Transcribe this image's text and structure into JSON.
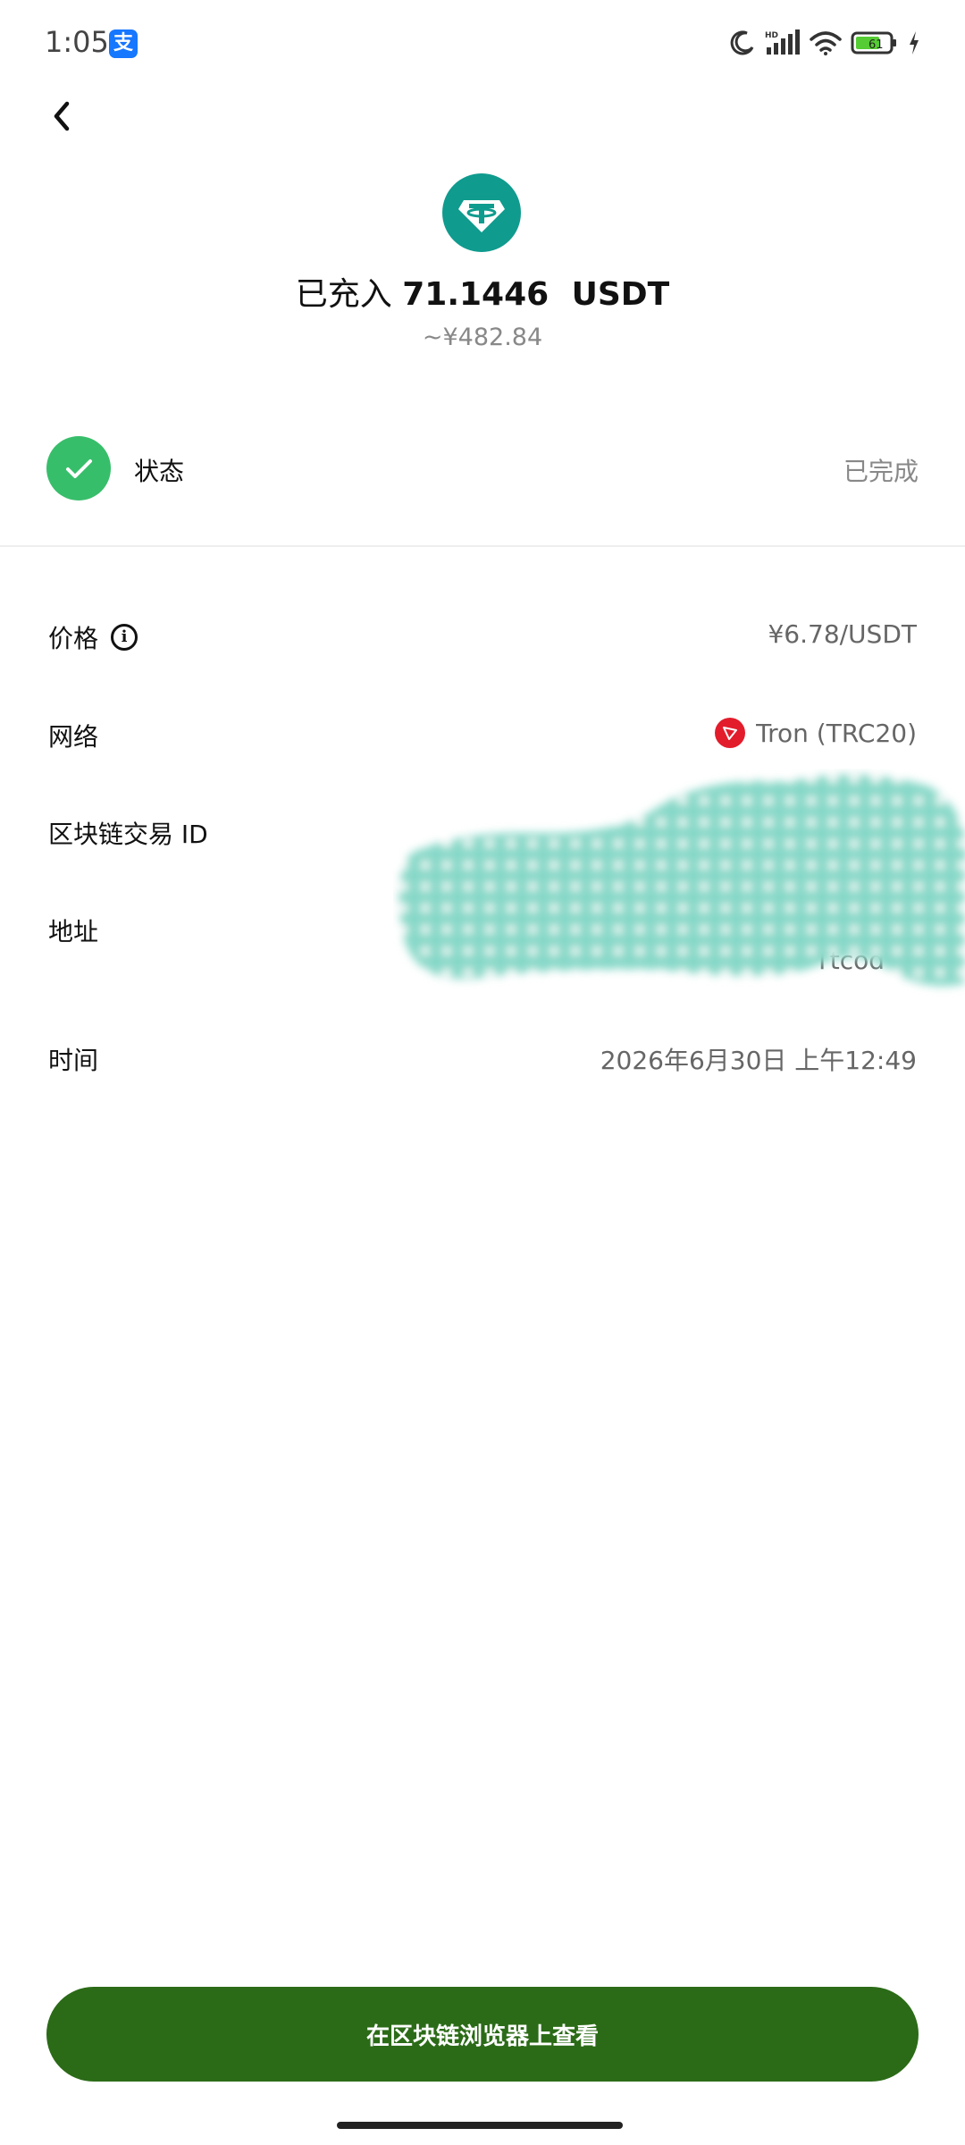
{
  "status_bar": {
    "time": "1:05",
    "app_badge": "支",
    "battery": "61"
  },
  "header": {
    "token_icon": "tether-icon",
    "prefix": "已充入",
    "amount": "71.1446",
    "unit": "USDT",
    "fiat_value": "~¥482.84"
  },
  "status": {
    "label": "状态",
    "value": "已完成",
    "color": "#37be6a"
  },
  "details": {
    "price": {
      "label": "价格",
      "value": "¥6.78/USDT"
    },
    "network": {
      "label": "网络",
      "value": "Tron (TRC20)"
    },
    "tx_id": {
      "label": "区块链交易 ID",
      "value": ""
    },
    "address": {
      "label": "地址",
      "value": "Ttcod"
    },
    "time": {
      "label": "时间",
      "value": "2026年6月30日 上午12:49"
    }
  },
  "actions": {
    "explorer_button": "在区块链浏览器上查看",
    "button_color": "#2b6b17"
  }
}
